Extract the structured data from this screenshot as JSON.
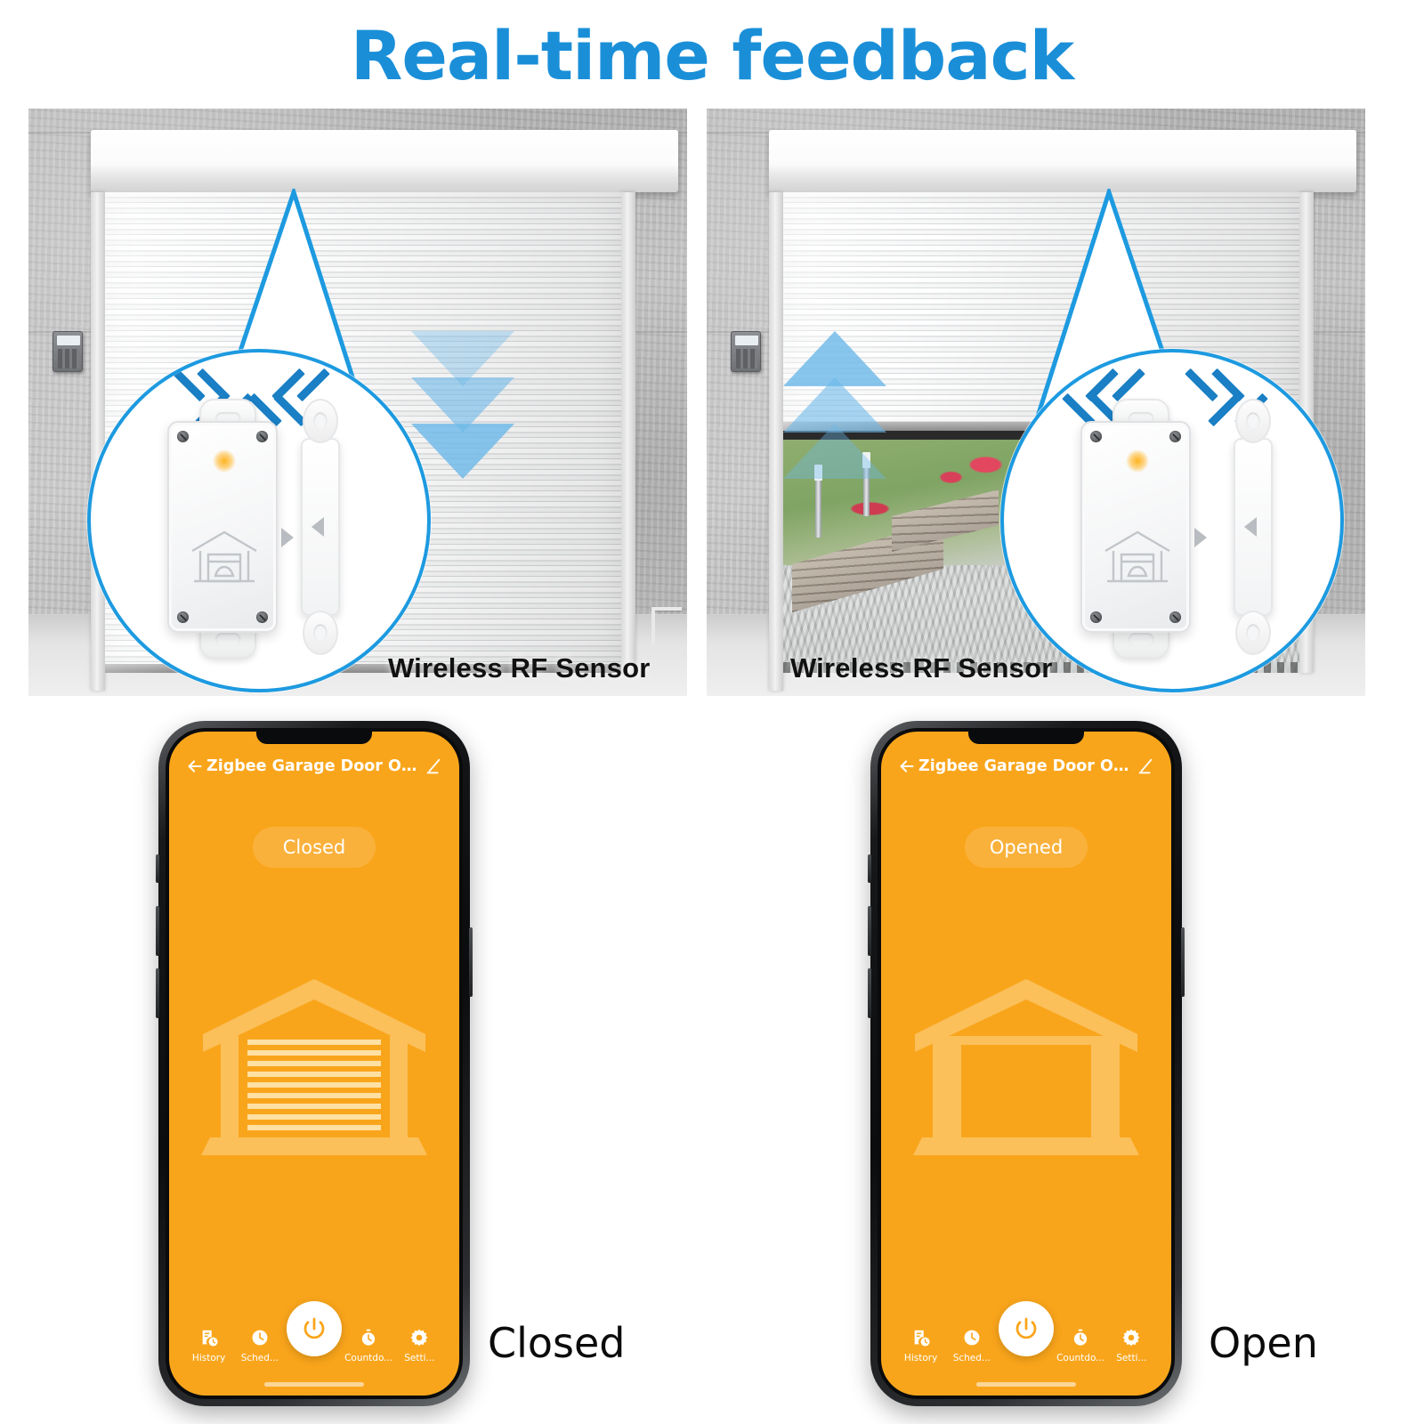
{
  "page": {
    "title": "Real-time feedback",
    "title_color": "#1a8fd8",
    "background": "#ffffff"
  },
  "panels": [
    {
      "id": "closed",
      "door_state": "closed",
      "motion_direction": "down",
      "sensor_label": "Wireless RF Sensor",
      "sensor_chevrons": "inward",
      "caption": "Closed"
    },
    {
      "id": "open",
      "door_state": "open",
      "motion_direction": "up",
      "sensor_label": "Wireless RF Sensor",
      "sensor_chevrons": "outward",
      "caption": "Open"
    }
  ],
  "phones": [
    {
      "id": "phone-closed",
      "app_title": "Zigbee Garage Door Open...",
      "back_icon": "back-arrow-icon",
      "edit_icon": "pencil-edit-icon",
      "status": "Closed",
      "garage_icon": "garage-closed-icon",
      "accent": "#F9A51B",
      "tabs": [
        {
          "label": "History",
          "icon": "history-icon"
        },
        {
          "label": "Sched...",
          "icon": "clock-icon"
        },
        {
          "label": "",
          "icon": "power-icon"
        },
        {
          "label": "Countdo...",
          "icon": "stopwatch-icon"
        },
        {
          "label": "Setti...",
          "icon": "gear-icon"
        }
      ]
    },
    {
      "id": "phone-open",
      "app_title": "Zigbee Garage Door Open...",
      "back_icon": "back-arrow-icon",
      "edit_icon": "pencil-edit-icon",
      "status": "Opened",
      "garage_icon": "garage-open-icon",
      "accent": "#F9A51B",
      "tabs": [
        {
          "label": "History",
          "icon": "history-icon"
        },
        {
          "label": "Sched...",
          "icon": "clock-icon"
        },
        {
          "label": "",
          "icon": "power-icon"
        },
        {
          "label": "Countdo...",
          "icon": "stopwatch-icon"
        },
        {
          "label": "Setti...",
          "icon": "gear-icon"
        }
      ]
    }
  ],
  "colors": {
    "brand_blue": "#1a8fd8",
    "lens_border": "#1d9ae0",
    "chevron_blue": "#1a7fc4",
    "motion_arrow": "#6db8e9",
    "app_orange": "#F9A51B",
    "led_amber": "#ffb422"
  }
}
